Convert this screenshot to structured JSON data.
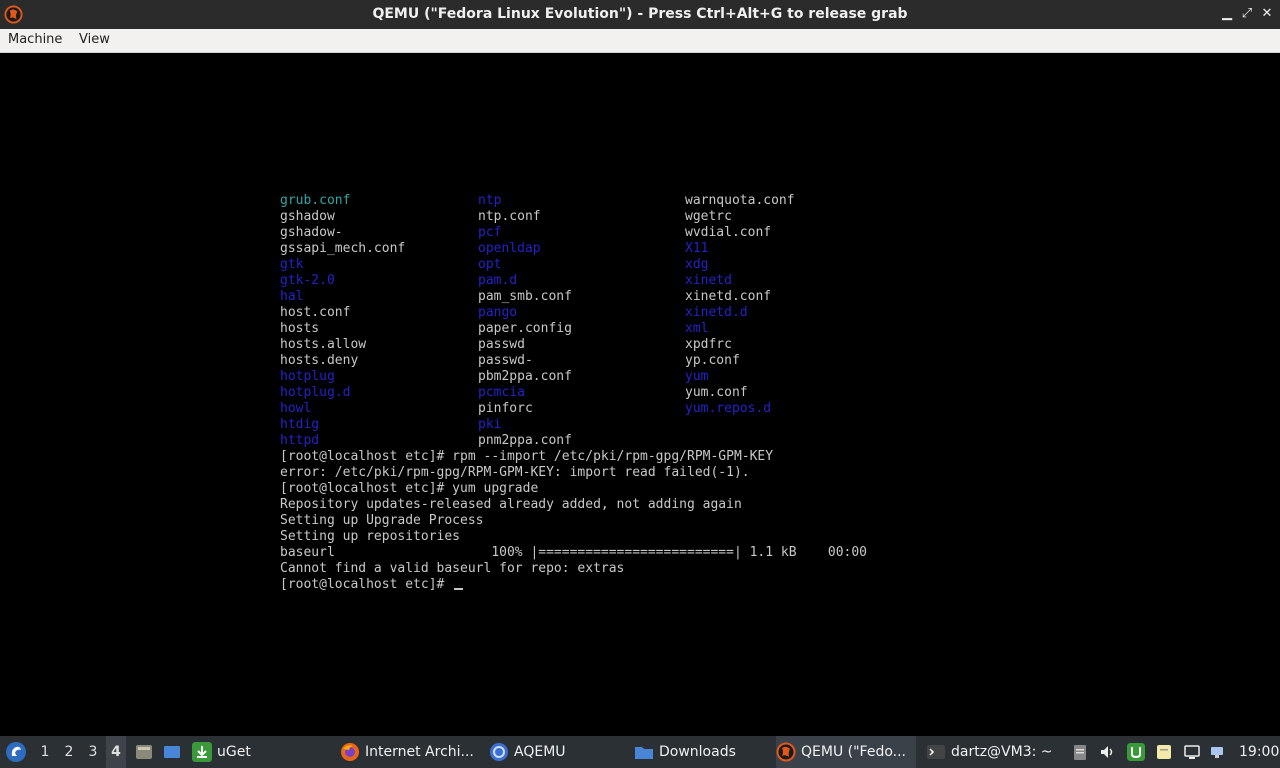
{
  "window": {
    "title": "QEMU (\"Fedora Linux Evolution\") - Press Ctrl+Alt+G to release grab",
    "minimize_glyph": "▁",
    "restore_glyph": "⤢",
    "close_glyph": "✕"
  },
  "menu": {
    "items": [
      "Machine",
      "View"
    ]
  },
  "terminal": {
    "listing": [
      [
        {
          "t": "grub.conf",
          "c": "cyan"
        },
        {
          "t": "ntp",
          "c": "blue"
        },
        {
          "t": "warnquota.conf",
          "c": "plain"
        }
      ],
      [
        {
          "t": "gshadow",
          "c": "plain"
        },
        {
          "t": "ntp.conf",
          "c": "plain"
        },
        {
          "t": "wgetrc",
          "c": "plain"
        }
      ],
      [
        {
          "t": "gshadow-",
          "c": "plain"
        },
        {
          "t": "pcf",
          "c": "blue"
        },
        {
          "t": "wvdial.conf",
          "c": "plain"
        }
      ],
      [
        {
          "t": "gssapi_mech.conf",
          "c": "plain"
        },
        {
          "t": "openldap",
          "c": "blue"
        },
        {
          "t": "X11",
          "c": "blue"
        }
      ],
      [
        {
          "t": "gtk",
          "c": "blue"
        },
        {
          "t": "opt",
          "c": "blue"
        },
        {
          "t": "xdg",
          "c": "blue"
        }
      ],
      [
        {
          "t": "gtk-2.0",
          "c": "blue"
        },
        {
          "t": "pam.d",
          "c": "blue"
        },
        {
          "t": "xinetd",
          "c": "blue"
        }
      ],
      [
        {
          "t": "hal",
          "c": "blue"
        },
        {
          "t": "pam_smb.conf",
          "c": "plain"
        },
        {
          "t": "xinetd.conf",
          "c": "plain"
        }
      ],
      [
        {
          "t": "host.conf",
          "c": "plain"
        },
        {
          "t": "pango",
          "c": "blue"
        },
        {
          "t": "xinetd.d",
          "c": "blue"
        }
      ],
      [
        {
          "t": "hosts",
          "c": "plain"
        },
        {
          "t": "paper.config",
          "c": "plain"
        },
        {
          "t": "xml",
          "c": "blue"
        }
      ],
      [
        {
          "t": "hosts.allow",
          "c": "plain"
        },
        {
          "t": "passwd",
          "c": "plain"
        },
        {
          "t": "xpdfrc",
          "c": "plain"
        }
      ],
      [
        {
          "t": "hosts.deny",
          "c": "plain"
        },
        {
          "t": "passwd-",
          "c": "plain"
        },
        {
          "t": "yp.conf",
          "c": "plain"
        }
      ],
      [
        {
          "t": "hotplug",
          "c": "blue"
        },
        {
          "t": "pbm2ppa.conf",
          "c": "plain"
        },
        {
          "t": "yum",
          "c": "blue"
        }
      ],
      [
        {
          "t": "hotplug.d",
          "c": "blue"
        },
        {
          "t": "pcmcia",
          "c": "blue"
        },
        {
          "t": "yum.conf",
          "c": "plain"
        }
      ],
      [
        {
          "t": "howl",
          "c": "blue"
        },
        {
          "t": "pinforc",
          "c": "plain"
        },
        {
          "t": "yum.repos.d",
          "c": "blue"
        }
      ],
      [
        {
          "t": "htdig",
          "c": "blue"
        },
        {
          "t": "pki",
          "c": "blue"
        },
        {
          "t": "",
          "c": "plain"
        }
      ],
      [
        {
          "t": "httpd",
          "c": "blue"
        },
        {
          "t": "pnm2ppa.conf",
          "c": "plain"
        },
        {
          "t": "",
          "c": "plain"
        }
      ]
    ],
    "output": [
      "[root@localhost etc]# rpm --import /etc/pki/rpm-gpg/RPM-GPM-KEY",
      "error: /etc/pki/rpm-gpg/RPM-GPM-KEY: import read failed(-1).",
      "[root@localhost etc]# yum upgrade",
      "Repository updates-released already added, not adding again",
      "Setting up Upgrade Process",
      "Setting up repositories",
      "baseurl                    100% |=========================| 1.1 kB    00:00",
      "Cannot find a valid baseurl for repo: extras"
    ],
    "prompt": "[root@localhost etc]# "
  },
  "taskbar": {
    "workspaces": [
      "1",
      "2",
      "3",
      "4"
    ],
    "active_workspace": "4",
    "tasks": [
      {
        "label": "uGet",
        "icon": "uget-icon",
        "color": "#3a9a3a"
      },
      {
        "label": "Internet Archi...",
        "icon": "firefox-icon",
        "color": "#e8661c"
      },
      {
        "label": "AQEMU",
        "icon": "aqemu-icon",
        "color": "#3b6fd8"
      },
      {
        "label": "Downloads",
        "icon": "folder-icon",
        "color": "#4a86d8"
      },
      {
        "label": "QEMU (\"Fedo...",
        "icon": "qemu-icon",
        "color": "#e0581a"
      },
      {
        "label": "dartz@VM3: ~",
        "icon": "terminal-icon",
        "color": "#444"
      }
    ],
    "clock": "19:00"
  }
}
